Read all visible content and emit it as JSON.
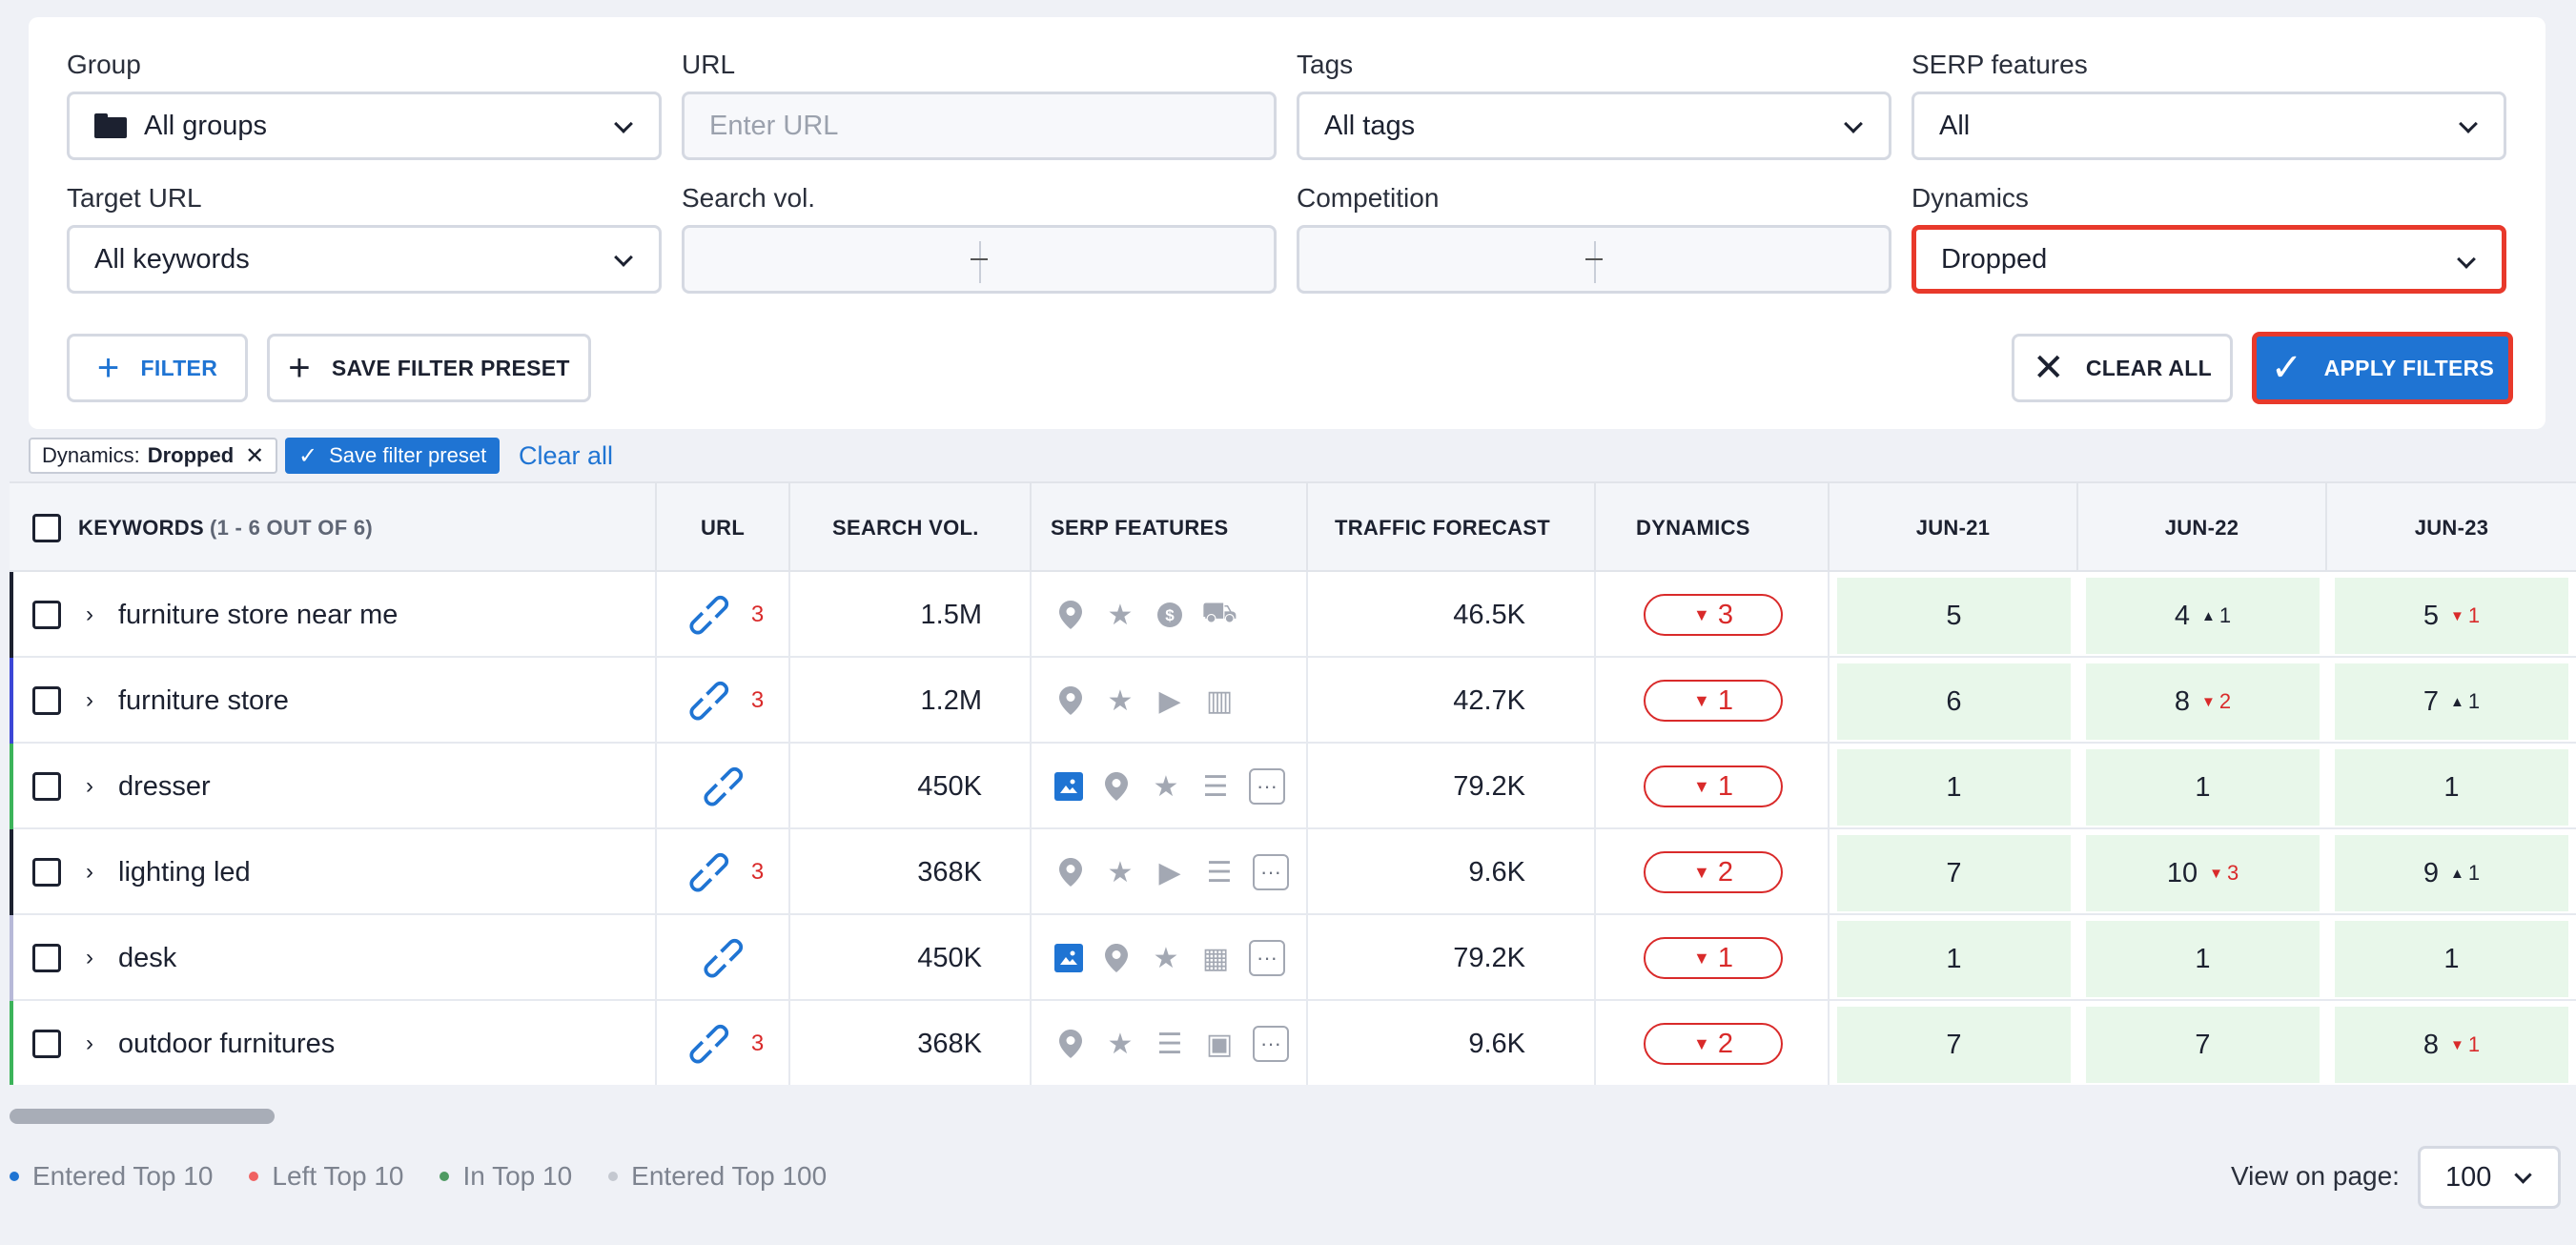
{
  "filters": {
    "group": {
      "label": "Group",
      "value": "All groups"
    },
    "url": {
      "label": "URL",
      "placeholder": "Enter URL"
    },
    "tags": {
      "label": "Tags",
      "value": "All tags"
    },
    "serp": {
      "label": "SERP features",
      "value": "All"
    },
    "target_url": {
      "label": "Target URL",
      "value": "All keywords"
    },
    "search_vol": {
      "label": "Search vol."
    },
    "competition": {
      "label": "Competition"
    },
    "dynamics": {
      "label": "Dynamics",
      "value": "Dropped"
    },
    "buttons": {
      "filter": "FILTER",
      "save_preset": "SAVE FILTER PRESET",
      "clear_all": "CLEAR ALL",
      "apply": "APPLY FILTERS"
    }
  },
  "active_chips": {
    "dynamics_label": "Dynamics:",
    "dynamics_value": "Dropped",
    "save_preset": "Save filter preset",
    "clear_all": "Clear all"
  },
  "table": {
    "headers": {
      "keywords": "KEYWORDS",
      "keywords_count": "(1 - 6 OUT OF 6)",
      "url": "URL",
      "search_vol": "SEARCH VOL.",
      "serp": "SERP FEATURES",
      "traffic": "TRAFFIC FORECAST",
      "dynamics": "DYNAMICS",
      "d1": "JUN-21",
      "d2": "JUN-22",
      "d3": "JUN-23"
    },
    "rows": [
      {
        "keyword": "furniture store near me",
        "bar_color": "#1c2130",
        "url_count": "3",
        "search_vol": "1.5M",
        "serp": [
          "pin-icon",
          "star-icon",
          "dollar-icon",
          "basket-icon"
        ],
        "traffic": "46.5K",
        "dynamics": "3",
        "p1": "5",
        "p2": "4",
        "p2_delta": "1",
        "p2_dir": "up",
        "p3": "5",
        "p3_delta": "1",
        "p3_dir": "down"
      },
      {
        "keyword": "furniture store",
        "bar_color": "#3c46d6",
        "url_count": "3",
        "search_vol": "1.2M",
        "serp": [
          "pin-icon",
          "star-icon",
          "video-icon",
          "carousel-icon"
        ],
        "traffic": "42.7K",
        "dynamics": "1",
        "p1": "6",
        "p2": "8",
        "p2_delta": "2",
        "p2_dir": "down",
        "p3": "7",
        "p3_delta": "1",
        "p3_dir": "up"
      },
      {
        "keyword": "dresser",
        "bar_color": "#3cb35a",
        "url_count": "",
        "search_vol": "450K",
        "serp": [
          "image-icon",
          "pin-icon",
          "star-icon",
          "list-icon",
          "more-icon"
        ],
        "traffic": "79.2K",
        "dynamics": "1",
        "p1": "1",
        "p2": "1",
        "p2_delta": "",
        "p2_dir": "",
        "p3": "1",
        "p3_delta": "",
        "p3_dir": ""
      },
      {
        "keyword": "lighting led",
        "bar_color": "#1c2130",
        "url_count": "3",
        "search_vol": "368K",
        "serp": [
          "pin-icon",
          "star-icon",
          "video-icon",
          "list-icon",
          "more-icon"
        ],
        "traffic": "9.6K",
        "dynamics": "2",
        "p1": "7",
        "p2": "10",
        "p2_delta": "3",
        "p2_dir": "down",
        "p3": "9",
        "p3_delta": "1",
        "p3_dir": "up"
      },
      {
        "keyword": "desk",
        "bar_color": "#b7b9d8",
        "url_count": "",
        "search_vol": "450K",
        "serp": [
          "image-icon",
          "pin-icon",
          "star-icon",
          "table-icon",
          "more-icon"
        ],
        "traffic": "79.2K",
        "dynamics": "1",
        "p1": "1",
        "p2": "1",
        "p2_delta": "",
        "p2_dir": "",
        "p3": "1",
        "p3_delta": "",
        "p3_dir": ""
      },
      {
        "keyword": "outdoor furnitures",
        "bar_color": "#3cb35a",
        "url_count": "3",
        "search_vol": "368K",
        "serp": [
          "pin-icon",
          "star-icon",
          "list-icon",
          "gallery-icon",
          "more-icon"
        ],
        "traffic": "9.6K",
        "dynamics": "2",
        "p1": "7",
        "p2": "7",
        "p2_delta": "",
        "p2_dir": "",
        "p3": "8",
        "p3_delta": "1",
        "p3_dir": "down"
      }
    ]
  },
  "legend": [
    {
      "label": "Entered Top 10",
      "color": "#1f74d3"
    },
    {
      "label": "Left Top 10",
      "color": "#f06262"
    },
    {
      "label": "In Top 10",
      "color": "#4e9a62"
    },
    {
      "label": "Entered Top 100",
      "color": "#c4c8d0"
    }
  ],
  "pagination": {
    "label": "View on page:",
    "value": "100"
  }
}
